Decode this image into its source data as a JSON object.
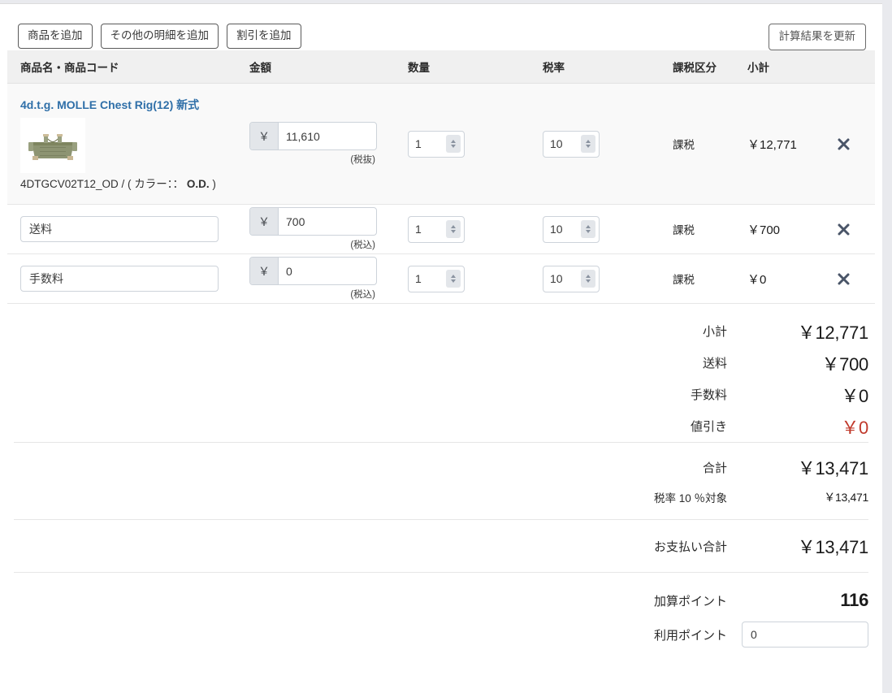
{
  "toolbar": {
    "add_product_label": "商品を追加",
    "add_other_label": "その他の明細を追加",
    "add_discount_label": "割引を追加",
    "recalculate_label": "計算結果を更新"
  },
  "table": {
    "headers": {
      "name": "商品名・商品コード",
      "amount": "金額",
      "quantity": "数量",
      "tax_rate": "税率",
      "tax_category": "課税区分",
      "subtotal": "小計"
    },
    "rows": [
      {
        "type": "product",
        "title": "4d.t.g. MOLLE Chest Rig(12) 新式",
        "sku_prefix": "4DTGCV02T12_OD / ( カラー：：",
        "sku_bold": "O.D.",
        "sku_suffix": ")",
        "currency_symbol": "￥",
        "amount": "11,610",
        "tax_note": "(税抜)",
        "quantity": "1",
        "tax_rate": "10",
        "tax_category": "課税",
        "subtotal": "￥12,771",
        "delete_icon": "close-icon"
      },
      {
        "type": "extra",
        "name_value": "送料",
        "currency_symbol": "￥",
        "amount": "700",
        "tax_note": "(税込)",
        "quantity": "1",
        "tax_rate": "10",
        "tax_category": "課税",
        "subtotal": "￥700",
        "delete_icon": "close-icon"
      },
      {
        "type": "extra",
        "name_value": "手数料",
        "currency_symbol": "￥",
        "amount": "0",
        "tax_note": "(税込)",
        "quantity": "1",
        "tax_rate": "10",
        "tax_category": "課税",
        "subtotal": "￥0",
        "delete_icon": "close-icon"
      }
    ]
  },
  "summary": {
    "subtotal_label": "小計",
    "subtotal_value": "￥12,771",
    "shipping_label": "送料",
    "shipping_value": "￥700",
    "fee_label": "手数料",
    "fee_value": "￥0",
    "discount_label": "値引き",
    "discount_value": "￥0",
    "total_label": "合計",
    "total_value": "￥13,471",
    "taxable_label": "税率 10 ％対象",
    "taxable_value": "￥13,471",
    "payment_total_label": "お支払い合計",
    "payment_total_value": "￥13,471",
    "earned_points_label": "加算ポイント",
    "earned_points_value": "116",
    "used_points_label": "利用ポイント",
    "used_points_value": "0"
  },
  "colors": {
    "link": "#2f6fa8",
    "discount": "#c0392b",
    "header_bg": "#f0f0f0",
    "addon_bg": "#e3e6ea"
  }
}
